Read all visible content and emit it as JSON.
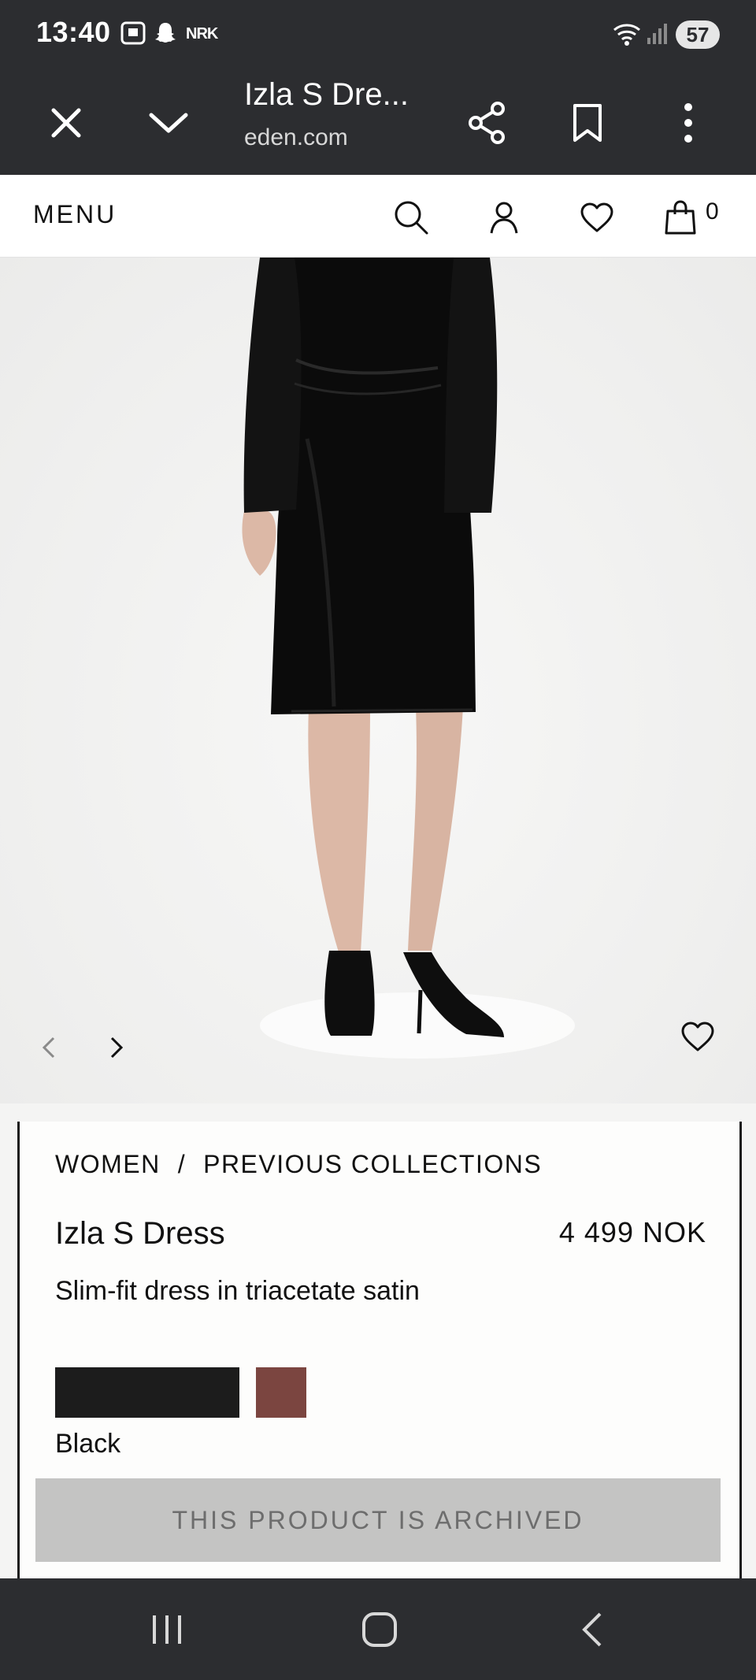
{
  "status_bar": {
    "time": "13:40",
    "notification_text": "NRK",
    "battery": "57"
  },
  "browser": {
    "page_title": "Izla S Dre...",
    "domain": "eden.com"
  },
  "site_header": {
    "menu_label": "MENU",
    "cart_count": "0"
  },
  "breadcrumb": {
    "items": [
      "WOMEN",
      "PREVIOUS COLLECTIONS"
    ],
    "separator": "/"
  },
  "product": {
    "name": "Izla S Dress",
    "price": "4 499 NOK",
    "description": "Slim-fit dress in triacetate satin",
    "selected_color": "Black",
    "swatches": [
      "#1c1c1c",
      "#7b4540"
    ],
    "archived_label": "THIS PRODUCT IS ARCHIVED"
  },
  "colors": {
    "chrome": "#2c2d30",
    "page_bg": "#f4f4f3",
    "archived_bg": "#c4c4c3",
    "archived_text": "#6d6d6d"
  }
}
